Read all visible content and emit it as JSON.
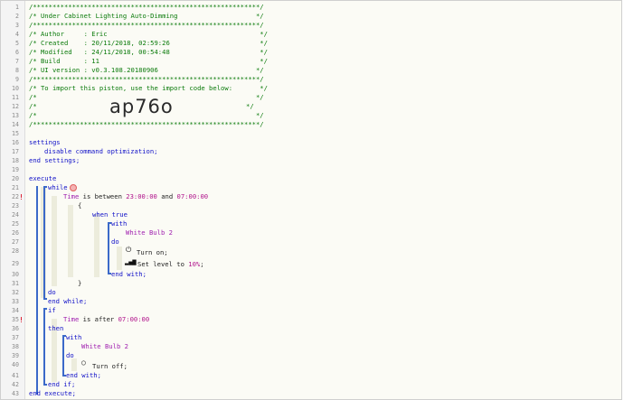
{
  "editor": {
    "line_numbers": [
      "1",
      "2",
      "3",
      "4",
      "5",
      "6",
      "7",
      "8",
      "9",
      "10",
      "11",
      "12",
      "13",
      "14",
      "15",
      "16",
      "17",
      "18",
      "19",
      "20",
      "21",
      "22",
      "23",
      "24",
      "25",
      "26",
      "27",
      "28",
      "29",
      "30",
      "31",
      "32",
      "33",
      "34",
      "35",
      "36",
      "37",
      "38",
      "39",
      "40",
      "41",
      "42",
      "43"
    ],
    "header_comment": {
      "border": "/**********************************************************/",
      "title": "/* Under Cabinet Lighting Auto-Dimming                    */",
      "author": "/* Author     : Eric                                       */",
      "created": "/* Created    : 20/11/2018, 02:59:26                       */",
      "modified": "/* Modified   : 24/11/2018, 00:54:48                       */",
      "build": "/* Build      : 11                                         */",
      "ui_version": "/* UI version : v0.3.108.20180906                         */",
      "import_note": "/* To import this piston, use the import code below:       */",
      "blank": "/*                                                        */",
      "import_code_prefix": "/*",
      "import_code_suffix": "*/",
      "import_code": "ap76o"
    },
    "code": {
      "settings": "settings",
      "disable_opt": "disable command optimization;",
      "end_settings": "end settings;",
      "execute": "execute",
      "while": "while",
      "time1": "Time",
      "is_between": " is between ",
      "time_from": "23:00:00",
      "and": " and ",
      "time_to": "07:00:00",
      "open_brace": "{",
      "when_true": "when true",
      "with1": "with",
      "device1": "White Bulb 2",
      "do1": "do",
      "turn_on": "Turn on;",
      "set_level": "Set level to ",
      "level_value": "10%",
      "semi": ";",
      "end_with1": "end with;",
      "close_brace": "}",
      "do_while": "do",
      "end_while": "end while;",
      "if": "if",
      "time2": "Time",
      "is_after": " is after ",
      "time_after": "07:00:00",
      "then": "then",
      "with2": "with",
      "device2": "White Bulb 2",
      "do2": "do",
      "turn_off": "Turn off;",
      "end_with2": "end with;",
      "end_if": "end if;",
      "end_execute": "end execute;"
    },
    "icons": {
      "power_on": "power-icon",
      "signal": "signal-bars-icon",
      "power_off": "power-off-icon",
      "stop": "stop-icon"
    },
    "colors": {
      "comment": "#0a7a0a",
      "keyword": "#1010c8",
      "device": "#a020b0",
      "value": "#b0108a",
      "block_line": "#3b69c9"
    }
  }
}
